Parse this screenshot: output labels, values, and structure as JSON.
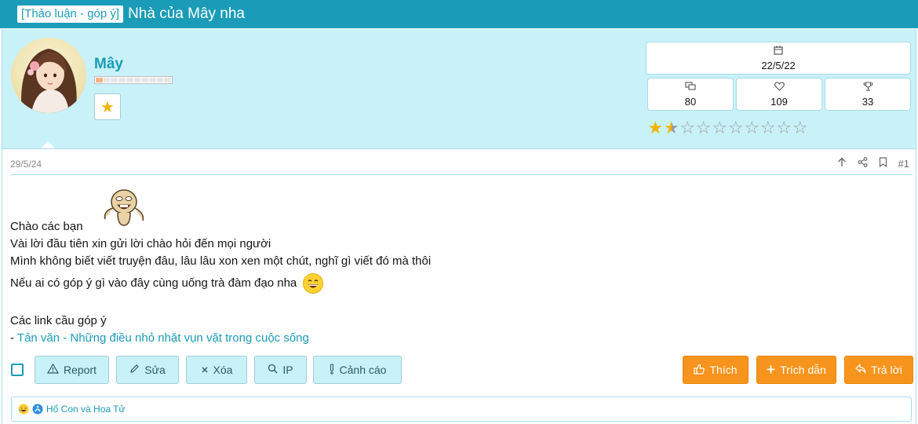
{
  "thread": {
    "prefix": "[Thảo luận - góp ý]",
    "title": "Nhà của Mây nha"
  },
  "user": {
    "name": "Mây",
    "badge_icon": "star-icon",
    "progress_level": 0.1
  },
  "stats": {
    "joined": "22/5/22",
    "messages": "80",
    "reactions": "109",
    "trophies": "33",
    "rating": 1.5,
    "rating_max": 10
  },
  "post": {
    "date": "29/5/24",
    "number": "#1",
    "lines": {
      "l1": "Chào các bạn",
      "l2": "Vài lời đầu tiên xin gửi lời chào hỏi đến mọi người",
      "l3": "Mình không biết viết truyện đâu, lâu lâu xon xen một chút, nghĩ gì viết đó mà thôi",
      "l4": "Nếu ai có góp ý gì vào đây cùng uống trà đàm đạo nha",
      "l5": "Các link cầu góp ý",
      "link_prefix": "- ",
      "link_text": "Tản văn - Những điều nhỏ nhặt vụn vặt trong cuộc sống"
    }
  },
  "actions": {
    "report": "Report",
    "edit": "Sửa",
    "delete": "Xóa",
    "ip": "IP",
    "warn": "Cảnh cáo",
    "like": "Thích",
    "quote": "Trích dẫn",
    "reply": "Trả lời"
  },
  "reactions_bar": {
    "users": "Hổ Con và Hoa Tử"
  },
  "colors": {
    "accent": "#1a9cb8",
    "panel": "#c9f1f8",
    "primary_button": "#f7941d",
    "star": "#f0b400"
  }
}
